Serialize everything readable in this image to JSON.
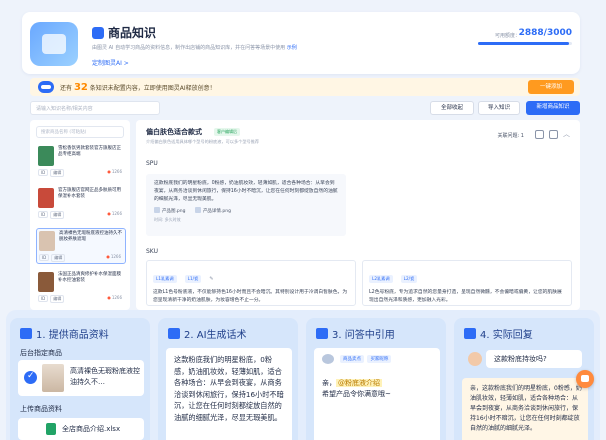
{
  "header": {
    "title": "商品知识",
    "desc": "由图灵 AI 自动学习商品的资料信息，制作出店铺的商品知识库，并在问答等场景中使用",
    "desc_link": "示例",
    "custom_label": "定制图灵AI >",
    "quota_label": "可用额度：",
    "quota_value": "2888/3000",
    "quota_fraction": 0.963
  },
  "notice": {
    "prefix": "还有",
    "count": "32",
    "text": "条知识未配置内容，立即使用图灵AI释放创意！",
    "button": "一键添加"
  },
  "toolbar": {
    "search_placeholder": "请输入知识名称/相关内容",
    "collapse_all": "全部收起",
    "import": "导入知识",
    "add": "新增商品知识"
  },
  "sidebar": {
    "search_placeholder": "搜索商品名称 (可粘贴)",
    "items": [
      {
        "name": "雪松香氛男款套装官方旗舰店正品专柜高端",
        "tag_id": "ID",
        "tag_edit": "编辑",
        "hot": "1266",
        "thumb": "#3b8a5a"
      },
      {
        "name": "官方旗舰店官网正品多肤质可用保湿补水套装",
        "tag_id": "ID",
        "tag_edit": "编辑",
        "hot": "1266",
        "thumb": "#c84a3a"
      },
      {
        "name": "高清裸色无瑕粉底液控油持久不脱妆养肤遮瑕",
        "tag_id": "ID",
        "tag_edit": "编辑",
        "hot": "1266",
        "thumb": "#d9c3b0"
      },
      {
        "name": "法国正品清爽修护补水保湿面膜补水控油套装",
        "tag_id": "ID",
        "tag_edit": "编辑",
        "hot": "1266",
        "thumb": "#8a5a3a"
      }
    ]
  },
  "main": {
    "title": "偏白肤色适合款式",
    "badge": "客户编辑后",
    "subtitle": "介绍偏白肤色适用具体哪个型号的粉底液，可以多个型号推荐",
    "related": "关联问题: 1",
    "spu_label": "SPU",
    "spu_text": "这款粉底我们的明星粉底，0粉感，奶油肌妆效，轻薄如肌，适合各种场合：从早会到夜宴，从商务洽谈到休闲旅行，保持16小时不暗沉，让您在任何时刻都绽放自然的油腻的细腻光泽，尽显无瑕美肌。",
    "files": [
      "产品图.png",
      "产品详情.png"
    ],
    "meta": "时间: 多久时效",
    "sku_label": "SKU",
    "sku": [
      {
        "chips": [
          "L1乳素调",
          "L1/瓷"
        ],
        "text": "这款L1色号粉底液，不仅能够持色16小时而且不会暗沉。其特别设计用于冷调白皙肤色，为您呈现清新干净的奶油肌肤，为妆容增色不止一分。"
      },
      {
        "chips": [
          "L2乳素调",
          "L2/瓷"
        ],
        "text": "L2色号粉底，专为追求自然的您量身打造，呈现自然微醺，不会偏暗或偏黄，让您的肌肤展现出自然光泽和质感，更加融入光彩。"
      }
    ]
  },
  "steps": [
    {
      "num": "1.",
      "title": "提供商品资料",
      "sub1": "后台指定商品",
      "product": "高清裸色无瑕粉底液控油持久不…",
      "sub2": "上传商品资料",
      "file": "全店商品介绍.xlsx"
    },
    {
      "num": "2.",
      "title": "AI生成话术",
      "text": "这款粉底我们的明星粉底，0粉感，奶油肌妆效，轻薄如肌，适合各种场合：从早会到夜宴，从商务洽谈到休闲旅行，保持16小时不暗沉，让您在任何时刻都绽放自然的油腻的细腻光泽，尽显无瑕美肌。"
    },
    {
      "num": "3.",
      "title": "问答中引用",
      "chips": [
        "商品卖点",
        "买家昵称"
      ],
      "msg_prefix": "亲，",
      "msg_hl": "@粉底液介绍",
      "msg_suffix": "希望产品令你满意哦~"
    },
    {
      "num": "4.",
      "title": "实际回复",
      "question": "这款粉底持妆吗?",
      "answer": "亲，这款粉底我们的明星粉底，0粉感，奶油肌妆效，轻薄如肌，适合各种场合：从早会到夜宴，从商务洽谈到休闲旅行，保持16小时不暗沉，让您在任何时刻都绽放自然的油腻的细腻光泽。"
    }
  ]
}
